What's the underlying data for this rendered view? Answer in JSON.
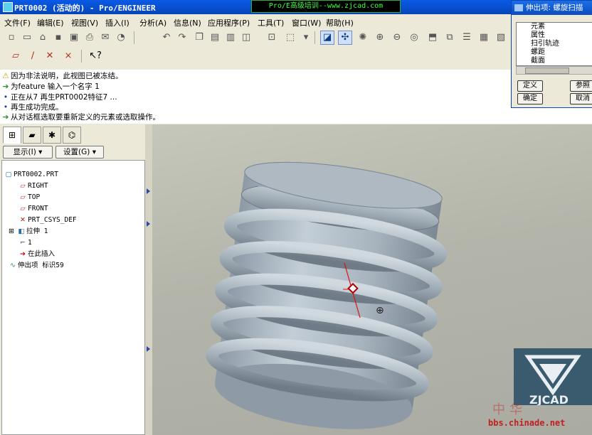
{
  "window": {
    "title": "PRT0002 (活动的) - Pro/ENGINEER",
    "banner": "Pro/E高级培训--www.zjcad.com"
  },
  "menu": [
    "文件(F)",
    "编辑(E)",
    "视图(V)",
    "插入(I)",
    "分析(A)",
    "信息(N)",
    "应用程序(P)",
    "工具(T)",
    "窗口(W)",
    "帮助(H)"
  ],
  "messages": [
    {
      "icon": "warning-icon",
      "text": "因为非法说明，此视图已被冻结。"
    },
    {
      "icon": "arrow-icon",
      "text": "为feature 输入一个名字   1"
    },
    {
      "icon": "bullet-icon",
      "text": "正在从7 再生PRT0002特征7 ..."
    },
    {
      "icon": "bullet-icon",
      "text": "再生成功完成。"
    },
    {
      "icon": "arrow-icon",
      "text": "从对话框选取要重新定义的元素或选取操作。"
    }
  ],
  "panel": {
    "show_button": "显示(I)",
    "settings_button": "设置(G)"
  },
  "tree": [
    {
      "icon": "part-icon",
      "label": "PRT0002.PRT"
    },
    {
      "icon": "datum-plane-icon",
      "label": "RIGHT"
    },
    {
      "icon": "datum-plane-icon",
      "label": "TOP"
    },
    {
      "icon": "datum-plane-icon",
      "label": "FRONT"
    },
    {
      "icon": "csys-icon",
      "label": "PRT_CSYS_DEF"
    },
    {
      "icon": "extrude-icon",
      "label": "拉伸 1"
    },
    {
      "icon": "sketch-icon",
      "label": "1"
    },
    {
      "icon": "insert-here-icon",
      "label": "在此插入"
    },
    {
      "icon": "sweep-icon",
      "label": "伸出项 标识59"
    }
  ],
  "dialog": {
    "title": "伸出项: 螺旋扫描",
    "column_header": "元素",
    "elements": [
      "属性",
      "扫引轨迹",
      "螺距",
      "截面"
    ],
    "buttons": {
      "define": "定义",
      "refs": "参照",
      "ok": "确定",
      "cancel": "取消"
    }
  },
  "watermark": {
    "url": "bbs.chinade.net",
    "cn": "中华",
    "logo": "ZJCAD"
  },
  "colors": {
    "title_bar": "#0645b8",
    "banner_text": "#3cff3c",
    "model": "#a9b6c0",
    "viewport": "#b8b9ae"
  }
}
